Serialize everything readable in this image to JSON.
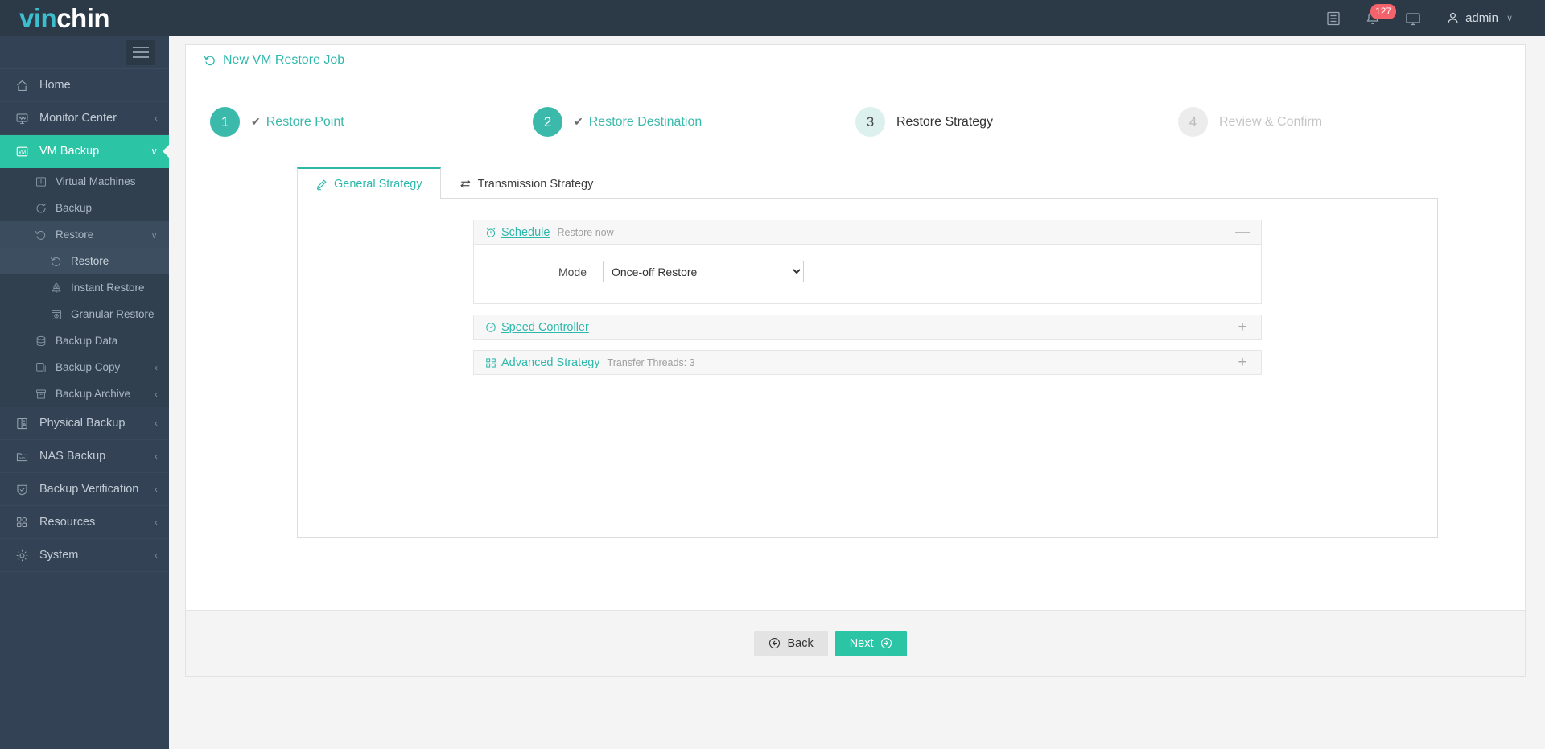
{
  "brand": {
    "part1": "vin",
    "part2": "chin"
  },
  "topbar": {
    "log_icon": "list-icon",
    "notification_icon": "bell-icon",
    "notification_count": "127",
    "display_icon": "monitor-icon",
    "user_icon": "user-icon",
    "user_name": "admin",
    "caret": "∨"
  },
  "sidebar": {
    "hamburger": "menu-icon",
    "items": [
      {
        "label": "Home",
        "icon": "home-icon",
        "chevron": "",
        "level": 0,
        "state": "normal"
      },
      {
        "label": "Monitor Center",
        "icon": "monitor-chart-icon",
        "chevron": "‹",
        "level": 0,
        "state": "normal"
      },
      {
        "label": "VM Backup",
        "icon": "vm-icon",
        "chevron": "∨",
        "level": 0,
        "state": "active"
      },
      {
        "label": "Virtual Machines",
        "icon": "chart-bars-icon",
        "chevron": "",
        "level": 1,
        "state": "normal"
      },
      {
        "label": "Backup",
        "icon": "refresh-icon",
        "chevron": "",
        "level": 1,
        "state": "normal"
      },
      {
        "label": "Restore",
        "icon": "restore-icon",
        "chevron": "∨",
        "level": 1,
        "state": "open"
      },
      {
        "label": "Restore",
        "icon": "restore-icon",
        "chevron": "",
        "level": 2,
        "state": "current"
      },
      {
        "label": "Instant Restore",
        "icon": "rocket-icon",
        "chevron": "",
        "level": 2,
        "state": "normal"
      },
      {
        "label": "Granular Restore",
        "icon": "granular-icon",
        "chevron": "",
        "level": 2,
        "state": "normal"
      },
      {
        "label": "Backup Data",
        "icon": "database-icon",
        "chevron": "",
        "level": 1,
        "state": "normal"
      },
      {
        "label": "Backup Copy",
        "icon": "copy-icon",
        "chevron": "‹",
        "level": 1,
        "state": "normal"
      },
      {
        "label": "Backup Archive",
        "icon": "archive-icon",
        "chevron": "‹",
        "level": 1,
        "state": "normal"
      },
      {
        "label": "Physical Backup",
        "icon": "server-icon",
        "chevron": "‹",
        "level": 0,
        "state": "normal"
      },
      {
        "label": "NAS Backup",
        "icon": "nas-icon",
        "chevron": "‹",
        "level": 0,
        "state": "normal"
      },
      {
        "label": "Backup Verification",
        "icon": "shield-check-icon",
        "chevron": "‹",
        "level": 0,
        "state": "normal"
      },
      {
        "label": "Resources",
        "icon": "grid-icon",
        "chevron": "‹",
        "level": 0,
        "state": "normal"
      },
      {
        "label": "System",
        "icon": "gear-icon",
        "chevron": "‹",
        "level": 0,
        "state": "normal"
      }
    ]
  },
  "page": {
    "title": "New VM Restore Job",
    "title_icon": "restore-icon"
  },
  "steps": [
    {
      "number": "1",
      "label": "Restore Point",
      "state": "done",
      "tick": "✔"
    },
    {
      "number": "2",
      "label": "Restore Destination",
      "state": "done",
      "tick": "✔"
    },
    {
      "number": "3",
      "label": "Restore Strategy",
      "state": "current",
      "tick": ""
    },
    {
      "number": "4",
      "label": "Review & Confirm",
      "state": "todo",
      "tick": ""
    }
  ],
  "tabs": [
    {
      "label": "General Strategy",
      "icon": "pencil-icon",
      "active": true
    },
    {
      "label": "Transmission Strategy",
      "icon": "transfer-icon",
      "active": false
    }
  ],
  "panels": [
    {
      "title": "Schedule",
      "icon": "alarm-clock-icon",
      "summary": "Restore now",
      "toggle": "—",
      "expanded": true
    },
    {
      "title": "Speed Controller",
      "icon": "speedometer-icon",
      "summary": "",
      "toggle": "+",
      "expanded": false
    },
    {
      "title": "Advanced Strategy",
      "icon": "blocks-icon",
      "summary": "Transfer Threads: 3",
      "toggle": "+",
      "expanded": false
    }
  ],
  "schedule_form": {
    "mode_label": "Mode",
    "mode_value": "Once-off Restore",
    "mode_options": [
      "Once-off Restore"
    ]
  },
  "footer": {
    "back_label": "Back",
    "back_icon": "arrow-left-circle-icon",
    "next_label": "Next",
    "next_icon": "arrow-right-circle-icon"
  },
  "colors": {
    "accent_teal": "#2bc4a5",
    "title_teal": "#2eb8ac",
    "sidebar_bg": "#334254",
    "topbar_bg": "#2c3a47",
    "badge_red": "#f4636b",
    "page_bg": "#f4f4f4"
  }
}
